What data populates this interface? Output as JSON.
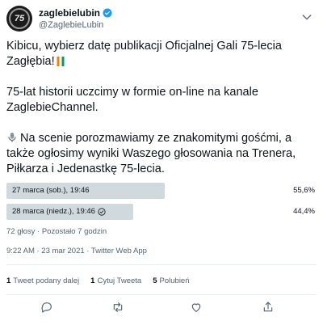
{
  "header": {
    "display_name": "zaglebielubin",
    "handle": "@ZaglebieLubin",
    "avatar_text": "75"
  },
  "tweet": {
    "paragraph1": "Kibicu, wybierz datę publikacji Oficjalnej Gali 75-lecia Zagłębia!",
    "paragraph2": "75-lat historii uczcimy w formie on-line na kanale ZaglebieChannel.",
    "paragraph3": "Na scenie porozmawiamy ze znakomitymi gośćmi, a także ogłosimy wyniki Waszego głosowania na Trenera, Piłkarza i Jedenastkę 75-lecia."
  },
  "poll": {
    "options": [
      {
        "label": "27 marca (sob.), 19:46",
        "percent_text": "55,6%",
        "percent": 55.6,
        "winner": false
      },
      {
        "label": "28 marca (niedz.), 19:46",
        "percent_text": "44,4%",
        "percent": 44.4,
        "winner": true
      }
    ],
    "meta": "72 głosy · Pozostało 7 godzin"
  },
  "timestamp": "9:22 AM · 23 mar 2021 · Twitter Web App",
  "stats": {
    "retweets_count": "1",
    "retweets_label": "Tweet podany dalej",
    "quotes_count": "1",
    "quotes_label": "Cytuj Tweeta",
    "likes_count": "5",
    "likes_label": "Polubień"
  },
  "colors": {
    "text": "#0f1419",
    "secondary": "#536471",
    "poll_bar": "#cfd9de",
    "verified": "#1d9bf0"
  },
  "icons": [
    "verified-badge-icon",
    "more-options-icon",
    "flag-icon",
    "microphone-icon",
    "check-circle-icon",
    "reply-icon",
    "retweet-icon",
    "like-icon",
    "share-icon"
  ]
}
